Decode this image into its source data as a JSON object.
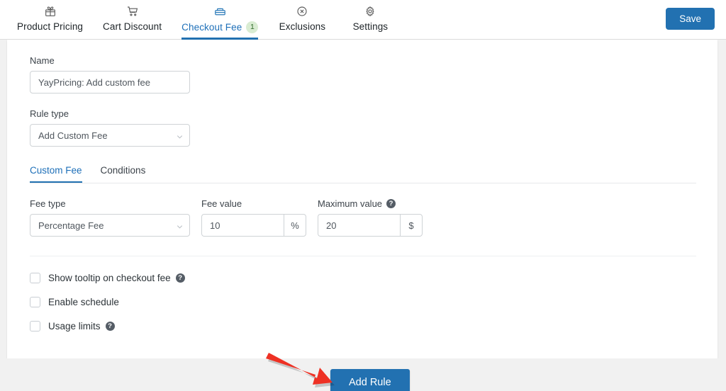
{
  "header": {
    "tabs": [
      {
        "label": "Product Pricing",
        "icon": "gift-icon",
        "active": false,
        "badge": null
      },
      {
        "label": "Cart Discount",
        "icon": "shopping-cart-icon",
        "active": false,
        "badge": null
      },
      {
        "label": "Checkout Fee",
        "icon": "cash-register-icon",
        "active": true,
        "badge": "1"
      },
      {
        "label": "Exclusions",
        "icon": "circle-x-icon",
        "active": false,
        "badge": null
      },
      {
        "label": "Settings",
        "icon": "gear-icon",
        "active": false,
        "badge": null
      }
    ],
    "save_label": "Save",
    "accent_color": "#2271b1",
    "badge_bg_color": "#d9ecd2",
    "badge_text_color": "#2f6a2a"
  },
  "form": {
    "name_label": "Name",
    "name_value": "YayPricing: Add custom fee",
    "name_placeholder": "Name",
    "rule_type_label": "Rule type",
    "rule_type_value": "Add Custom Fee",
    "inner_tabs": [
      {
        "label": "Custom Fee",
        "active": true
      },
      {
        "label": "Conditions",
        "active": false
      }
    ],
    "fee_type_label": "Fee type",
    "fee_type_value": "Percentage Fee",
    "fee_value_label": "Fee value",
    "fee_value": "10",
    "fee_value_suffix": "%",
    "maximum_value_label": "Maximum value",
    "maximum_value": "20",
    "maximum_value_suffix": "$",
    "help_glyph": "?",
    "checkboxes": [
      {
        "label": "Show tooltip on checkout fee",
        "checked": false,
        "help": true
      },
      {
        "label": "Enable schedule",
        "checked": false,
        "help": false
      },
      {
        "label": "Usage limits",
        "checked": false,
        "help": true
      }
    ]
  },
  "footer": {
    "add_rule_label": "Add Rule"
  },
  "annotation": {
    "arrow_color": "#ee3124",
    "arrow_name": "red-pointer-arrow"
  }
}
